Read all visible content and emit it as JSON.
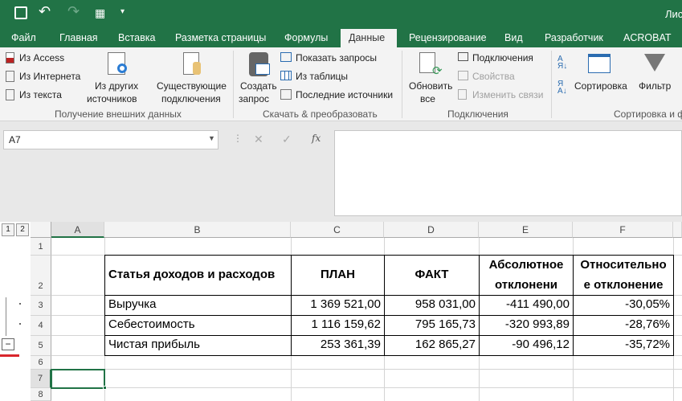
{
  "title_bar": {
    "title": "Лис"
  },
  "tabs": [
    "Файл",
    "Главная",
    "Вставка",
    "Разметка страницы",
    "Формулы",
    "Данные",
    "Рецензирование",
    "Вид",
    "Разработчик",
    "ACROBAT"
  ],
  "active_tab": "Данные",
  "ribbon": {
    "get_external": {
      "from_access": "Из Access",
      "from_web": "Из Интернета",
      "from_text": "Из текста",
      "other_1": "Из других",
      "other_2": "источников",
      "existing_1": "Существующие",
      "existing_2": "подключения",
      "label": "Получение внешних данных"
    },
    "transform": {
      "new_query_1": "Создать",
      "new_query_2": "запрос",
      "show_queries": "Показать запросы",
      "from_table": "Из таблицы",
      "recent_sources": "Последние источники",
      "label": "Скачать & преобразовать"
    },
    "connections": {
      "refresh_1": "Обновить",
      "refresh_2": "все",
      "connections": "Подключения",
      "properties": "Свойства",
      "edit_links": "Изменить связи",
      "label": "Подключения"
    },
    "sort_filter": {
      "sort": "Сортировка",
      "filter": "Фильтр",
      "label": "Сортировка и ф"
    }
  },
  "name_box": "A7",
  "formula_bar": {
    "fx": "fx",
    "value": ""
  },
  "outline": {
    "levels": [
      "1",
      "2"
    ],
    "collapse": "−"
  },
  "columns": [
    "A",
    "B",
    "C",
    "D",
    "E",
    "F"
  ],
  "rows": [
    "1",
    "2",
    "3",
    "4",
    "5",
    "6",
    "7",
    "8"
  ],
  "table": {
    "headers": [
      "Статья доходов и расходов",
      "ПЛАН",
      "ФАКТ",
      "Абсолютное отклонени",
      "Относительно е отклонение"
    ],
    "headers_e": [
      "Абсолютное",
      "отклонени"
    ],
    "headers_f": [
      "Относительно",
      "е отклонение"
    ],
    "rows": [
      [
        "Выручка",
        "1 369 521,00",
        "958 031,00",
        "-411 490,00",
        "-30,05%"
      ],
      [
        "Себестоимость",
        "1 116 159,62",
        "795 165,73",
        "-320 993,89",
        "-28,76%"
      ],
      [
        "Чистая прибыль",
        "253 361,39",
        "162 865,27",
        "-90 496,12",
        "-35,72%"
      ]
    ]
  },
  "colors": {
    "excel_green": "#217346",
    "ribbon_bg": "#f3f3f3"
  }
}
